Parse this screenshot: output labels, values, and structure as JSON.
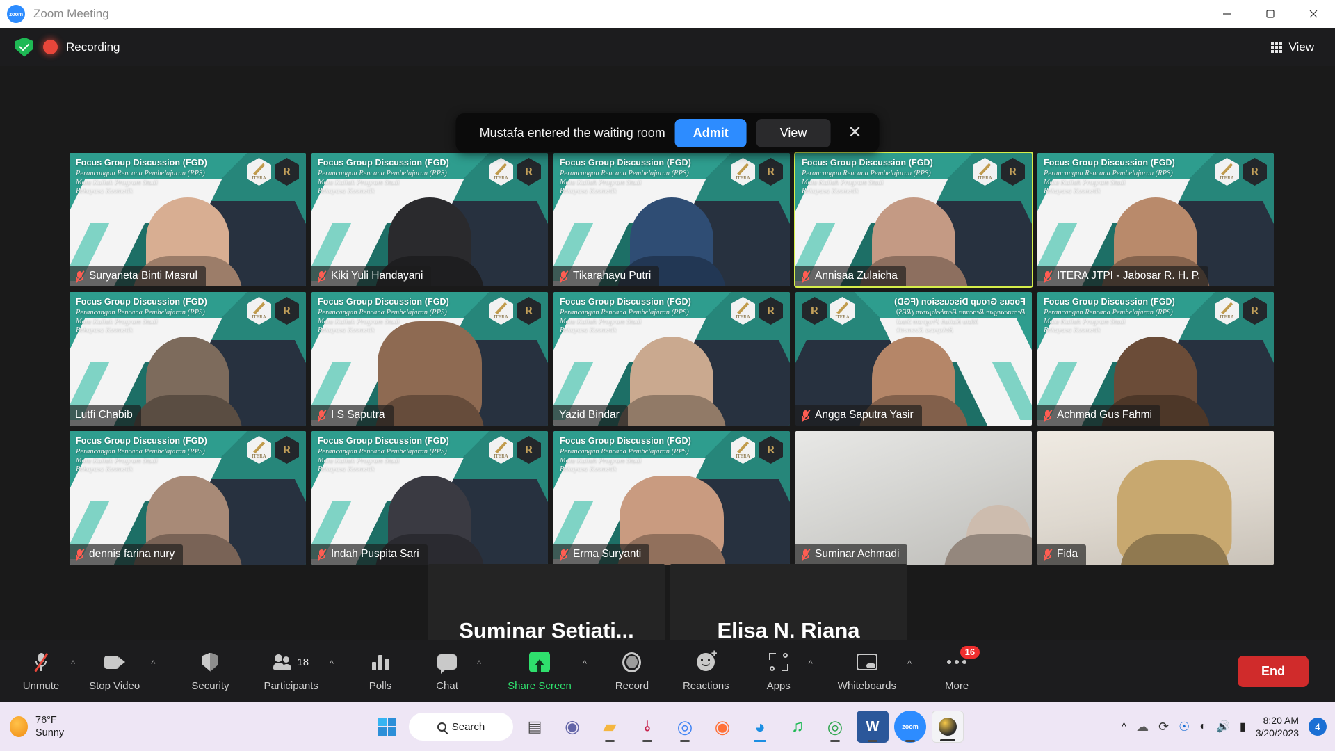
{
  "window": {
    "title": "Zoom Meeting",
    "app_icon": "zoom-logo",
    "minimize_label": "—",
    "maximize_label": "❐",
    "close_label": "✕"
  },
  "topbar": {
    "encryption_icon": "shield-check-icon",
    "recording_icon": "recording-dot-icon",
    "recording_label": "Recording",
    "view_icon": "grid-view-icon",
    "view_label": "View"
  },
  "waiting_room": {
    "message": "Mustafa entered the waiting room",
    "admit_label": "Admit",
    "view_label": "View",
    "close_label": "✕",
    "admit_color": "#2d8cff"
  },
  "virtual_background": {
    "title": "Focus Group Discussion (FGD)",
    "line1": "Perancangan Rencana Pembelajaran (RPS)",
    "line2": "Mata Kuliah Program Studi",
    "line3": "Rekayasa Kosmetik",
    "logo1": "ITERA",
    "logo2": "R"
  },
  "gallery": {
    "active_speaker_color": "#d6ee4a",
    "rows": [
      [
        {
          "name": "Suryaneta Binti Masrul",
          "muted": true,
          "active": false,
          "bg": "slide",
          "skin": "#d8ae92"
        },
        {
          "name": "Kiki Yuli Handayani",
          "muted": true,
          "active": false,
          "bg": "slide",
          "skin": "#2a2a2d"
        },
        {
          "name": "Tikarahayu Putri",
          "muted": true,
          "active": false,
          "bg": "slide",
          "skin": "#2f4d74"
        },
        {
          "name": "Annisaa Zulaicha",
          "muted": true,
          "active": true,
          "bg": "slide",
          "skin": "#c49a84"
        },
        {
          "name": "ITERA JTPI - Jabosar R. H. P.",
          "muted": true,
          "active": false,
          "bg": "slide",
          "skin": "#b98a6b"
        }
      ],
      [
        {
          "name": "Lutfi Chabib",
          "muted": false,
          "active": false,
          "bg": "slide",
          "skin": "#7d6b5c"
        },
        {
          "name": "I S Saputra",
          "muted": true,
          "active": false,
          "bg": "slide",
          "skin": "#8e6a52"
        },
        {
          "name": "Yazid Bindar",
          "muted": false,
          "active": false,
          "bg": "slide",
          "skin": "#caa98f"
        },
        {
          "name": "Angga Saputra Yasir",
          "muted": true,
          "active": false,
          "bg": "slide-flipped",
          "skin": "#b58668"
        },
        {
          "name": "Achmad Gus Fahmi",
          "muted": true,
          "active": false,
          "bg": "slide",
          "skin": "#6b4c38"
        }
      ],
      [
        {
          "name": "dennis farina nury",
          "muted": true,
          "active": false,
          "bg": "slide",
          "skin": "#a88a77"
        },
        {
          "name": "Indah Puspita Sari",
          "muted": true,
          "active": false,
          "bg": "slide",
          "skin": "#3a3a42"
        },
        {
          "name": "Erma Suryanti",
          "muted": true,
          "active": false,
          "bg": "slide",
          "skin": "#c99b80"
        },
        {
          "name": "Suminar Achmadi",
          "muted": true,
          "active": false,
          "bg": "camera",
          "skin": "#cdbcae"
        },
        {
          "name": "Fida",
          "muted": true,
          "active": false,
          "bg": "camera",
          "skin": "#c8a86f"
        }
      ]
    ],
    "bottom_pair": [
      {
        "name": "Suminar Setiati Achmadi - IPB Uni...",
        "avatar_text": "Suminar  Setiati...",
        "muted": true
      },
      {
        "name": "Elisa N. Riana",
        "avatar_text": "Elisa N. Riana",
        "muted": true
      }
    ]
  },
  "controls": {
    "items": [
      {
        "label": "Unmute",
        "icon": "microphone-muted-icon",
        "caret": true,
        "green": false
      },
      {
        "label": "Stop Video",
        "icon": "video-camera-icon",
        "caret": true,
        "green": false
      },
      {
        "label": "Security",
        "icon": "shield-icon",
        "caret": false,
        "green": false
      },
      {
        "label": "Participants",
        "icon": "participants-icon",
        "caret": true,
        "green": false,
        "count": "18"
      },
      {
        "label": "Polls",
        "icon": "polls-bars-icon",
        "caret": false,
        "green": false
      },
      {
        "label": "Chat",
        "icon": "chat-bubble-icon",
        "caret": true,
        "green": false
      },
      {
        "label": "Share Screen",
        "icon": "share-screen-icon",
        "caret": true,
        "green": true
      },
      {
        "label": "Record",
        "icon": "record-circle-icon",
        "caret": false,
        "green": false
      },
      {
        "label": "Reactions",
        "icon": "reactions-smiley-icon",
        "caret": false,
        "green": false
      },
      {
        "label": "Apps",
        "icon": "apps-icon",
        "caret": true,
        "green": false
      },
      {
        "label": "Whiteboards",
        "icon": "whiteboard-icon",
        "caret": true,
        "green": false
      },
      {
        "label": "More",
        "icon": "more-dots-icon",
        "caret": false,
        "green": false,
        "badge": "16"
      }
    ],
    "end_label": "End",
    "end_color": "#d02b2b"
  },
  "taskbar": {
    "weather_temp": "76°F",
    "weather_cond": "Sunny",
    "start_icon": "windows-start-icon",
    "search_label": "Search",
    "search_icon": "search-icon",
    "apps": [
      {
        "name": "task-view-icon",
        "glyph": "▣",
        "color": "#4a4a4a",
        "running": false
      },
      {
        "name": "microsoft-teams-icon",
        "glyph": "◉",
        "color": "#6264a7",
        "running": false
      },
      {
        "name": "file-explorer-icon",
        "glyph": "▤",
        "color": "#f5b63f",
        "running": true
      },
      {
        "name": "mendeley-icon",
        "glyph": "M",
        "color": "#c7254e",
        "running": true
      },
      {
        "name": "google-chrome-icon",
        "glyph": "◎",
        "color": "#4285f4",
        "running": true
      },
      {
        "name": "firefox-icon",
        "glyph": "◉",
        "color": "#ff7139",
        "running": false
      },
      {
        "name": "microsoft-edge-icon",
        "glyph": "◔",
        "color": "#1b8fe3",
        "running": true
      },
      {
        "name": "spotify-icon",
        "glyph": "♫",
        "color": "#1db954",
        "running": false
      },
      {
        "name": "chrome-beta-icon",
        "glyph": "◎",
        "color": "#34a853",
        "running": true
      },
      {
        "name": "microsoft-word-icon",
        "glyph": "W",
        "color": "#2b579a",
        "running": true
      },
      {
        "name": "zoom-app-icon",
        "glyph": "zoom",
        "color": "#2d8cff",
        "running": true
      },
      {
        "name": "browser-active-icon",
        "glyph": "◉",
        "color": "#222222",
        "running": true
      }
    ],
    "tray": [
      {
        "name": "show-hidden-icons-chevron",
        "glyph": "ⱎ"
      },
      {
        "name": "onedrive-error-icon",
        "glyph": "☁"
      },
      {
        "name": "sync-recording-icon",
        "glyph": "⟳"
      },
      {
        "name": "microphone-icon",
        "glyph": "♉"
      },
      {
        "name": "wifi-icon",
        "glyph": "◔"
      },
      {
        "name": "volume-icon",
        "glyph": "🔊"
      },
      {
        "name": "battery-icon",
        "glyph": "▬"
      }
    ],
    "time": "8:20 AM",
    "date": "3/20/2023",
    "notification_count": "4"
  }
}
